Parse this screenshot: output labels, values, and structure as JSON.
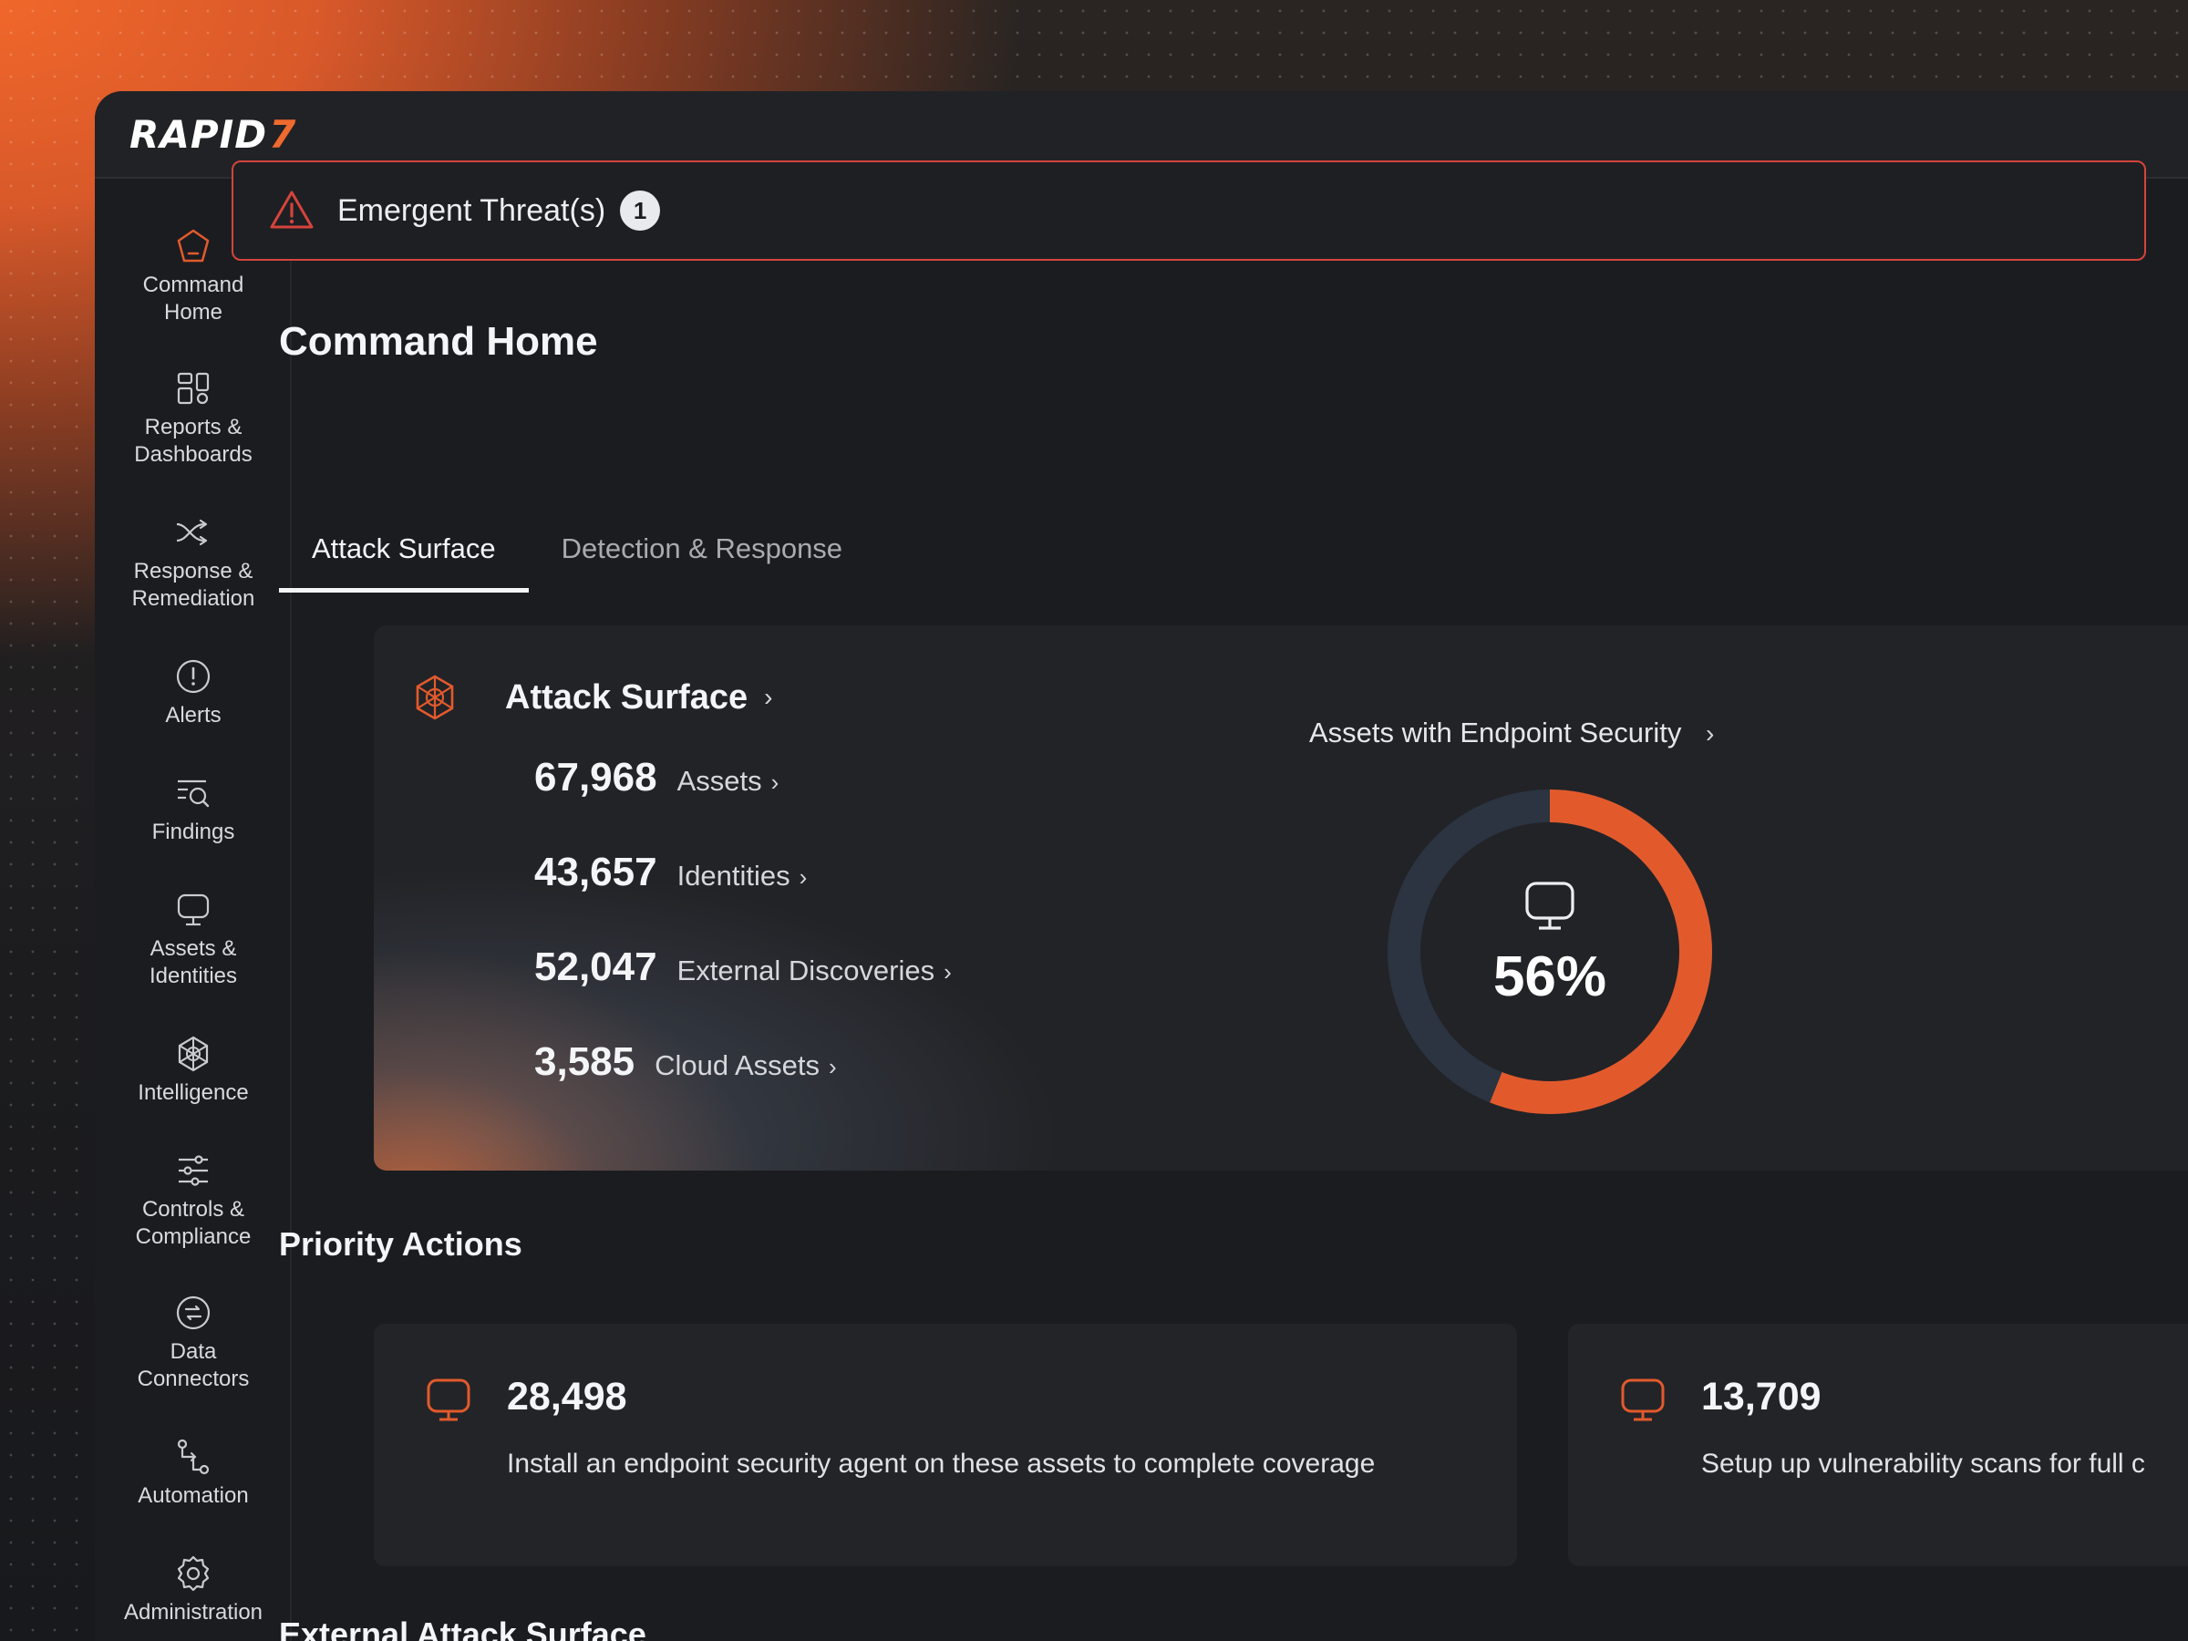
{
  "brand": {
    "logo_text": "RAPID",
    "logo_mark": "7"
  },
  "sidebar": {
    "items": [
      {
        "label": "Command\nHome",
        "icon": "home-icon",
        "active": true
      },
      {
        "label": "Reports &\nDashboards",
        "icon": "dashboard-icon"
      },
      {
        "label": "Response &\nRemediation",
        "icon": "shuffle-icon"
      },
      {
        "label": "Alerts",
        "icon": "alert-circle-icon"
      },
      {
        "label": "Findings",
        "icon": "findings-search-icon"
      },
      {
        "label": "Assets &\nIdentities",
        "icon": "monitor-icon"
      },
      {
        "label": "Intelligence",
        "icon": "network-icon"
      },
      {
        "label": "Controls &\nCompliance",
        "icon": "sliders-icon"
      },
      {
        "label": "Data\nConnectors",
        "icon": "connector-icon"
      },
      {
        "label": "Automation",
        "icon": "workflow-icon"
      },
      {
        "label": "Administration",
        "icon": "gear-icon"
      }
    ]
  },
  "alert": {
    "text": "Emergent Threat(s)",
    "count": "1"
  },
  "page": {
    "title": "Command Home"
  },
  "tabs": [
    {
      "label": "Attack Surface",
      "active": true
    },
    {
      "label": "Detection & Response",
      "active": false
    }
  ],
  "attack_surface": {
    "title": "Attack Surface",
    "chevron": "›",
    "stats": [
      {
        "value": "67,968",
        "label": "Assets"
      },
      {
        "value": "43,657",
        "label": "Identities"
      },
      {
        "value": "52,047",
        "label": "External Discoveries"
      },
      {
        "value": "3,585",
        "label": "Cloud Assets"
      }
    ],
    "endpoint": {
      "title": "Assets with Endpoint Security",
      "percent_text": "56%",
      "percent_value": 56
    }
  },
  "priority_actions": {
    "title": "Priority Actions",
    "cards": [
      {
        "value": "28,498",
        "text": "Install an endpoint security agent on these assets to complete coverage"
      },
      {
        "value": "13,709",
        "text": "Setup up vulnerability scans for full c"
      }
    ]
  },
  "external": {
    "title": "External Attack Surface"
  },
  "colors": {
    "accent": "#e25a2c",
    "alert_red": "#d4443b",
    "donut_track": "#2b3440"
  }
}
